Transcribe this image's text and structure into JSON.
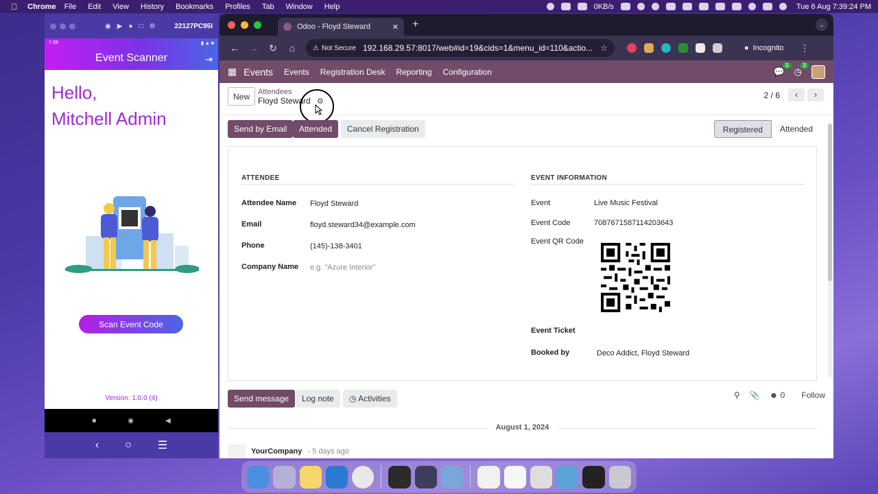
{
  "menubar": {
    "app_name": "Chrome",
    "items": [
      "File",
      "Edit",
      "View",
      "History",
      "Bookmarks",
      "Profiles",
      "Tab",
      "Window",
      "Help"
    ],
    "net_speed": "0KB/s",
    "clock": "Tue 6 Aug  7:39:24 PM"
  },
  "emulator": {
    "serial": "22127PC95I",
    "status_time": "7:39",
    "app_title": "Event Scanner",
    "greeting_line1": "Hello,",
    "greeting_line2": "Mitchell Admin",
    "scan_button": "Scan Event Code",
    "version": "Version: 1.0.0 (4)"
  },
  "browser": {
    "tab_title": "Odoo - Floyd Steward",
    "security_label": "Not Secure",
    "url": "192.168.29.57:8017/web#id=19&cids=1&menu_id=110&actio...",
    "profile_label": "Incognito"
  },
  "odoo": {
    "app_name": "Events",
    "menu": [
      "Events",
      "Registration Desk",
      "Reporting",
      "Configuration"
    ],
    "messages_count": "5",
    "activities_count": "3",
    "new_button": "New",
    "breadcrumb_parent": "Attendees",
    "breadcrumb_current": "Floyd Steward",
    "pager": "2 / 6",
    "actions": {
      "send_email": "Send by Email",
      "attended": "Attended",
      "cancel": "Cancel Registration"
    },
    "stages": [
      "Registered",
      "Attended"
    ],
    "attendee": {
      "section": "ATTENDEE",
      "name_label": "Attendee Name",
      "name": "Floyd Steward",
      "email_label": "Email",
      "email": "floyd.steward34@example.com",
      "phone_label": "Phone",
      "phone": "(145)-138-3401",
      "company_label": "Company Name",
      "company_placeholder": "e.g. \"Azure Interior\""
    },
    "event_info": {
      "section": "EVENT INFORMATION",
      "event_label": "Event",
      "event": "Live Music Festival",
      "code_label": "Event Code",
      "code": "7087671587114203643",
      "qr_label": "Event QR Code",
      "ticket_label": "Event Ticket",
      "booked_label": "Booked by",
      "booked_by": "Deco Addict, Floyd Steward"
    },
    "chatter": {
      "send_message": "Send message",
      "log_note": "Log note",
      "activities": "Activities",
      "followers_count": "0",
      "follow": "Follow",
      "date": "August 1, 2024",
      "author": "YourCompany",
      "when": "- 5 days ago"
    }
  },
  "colors": {
    "odoo_primary": "#714b67",
    "app_gradient_start": "#c31ef2",
    "app_gradient_end": "#4a66e6"
  }
}
